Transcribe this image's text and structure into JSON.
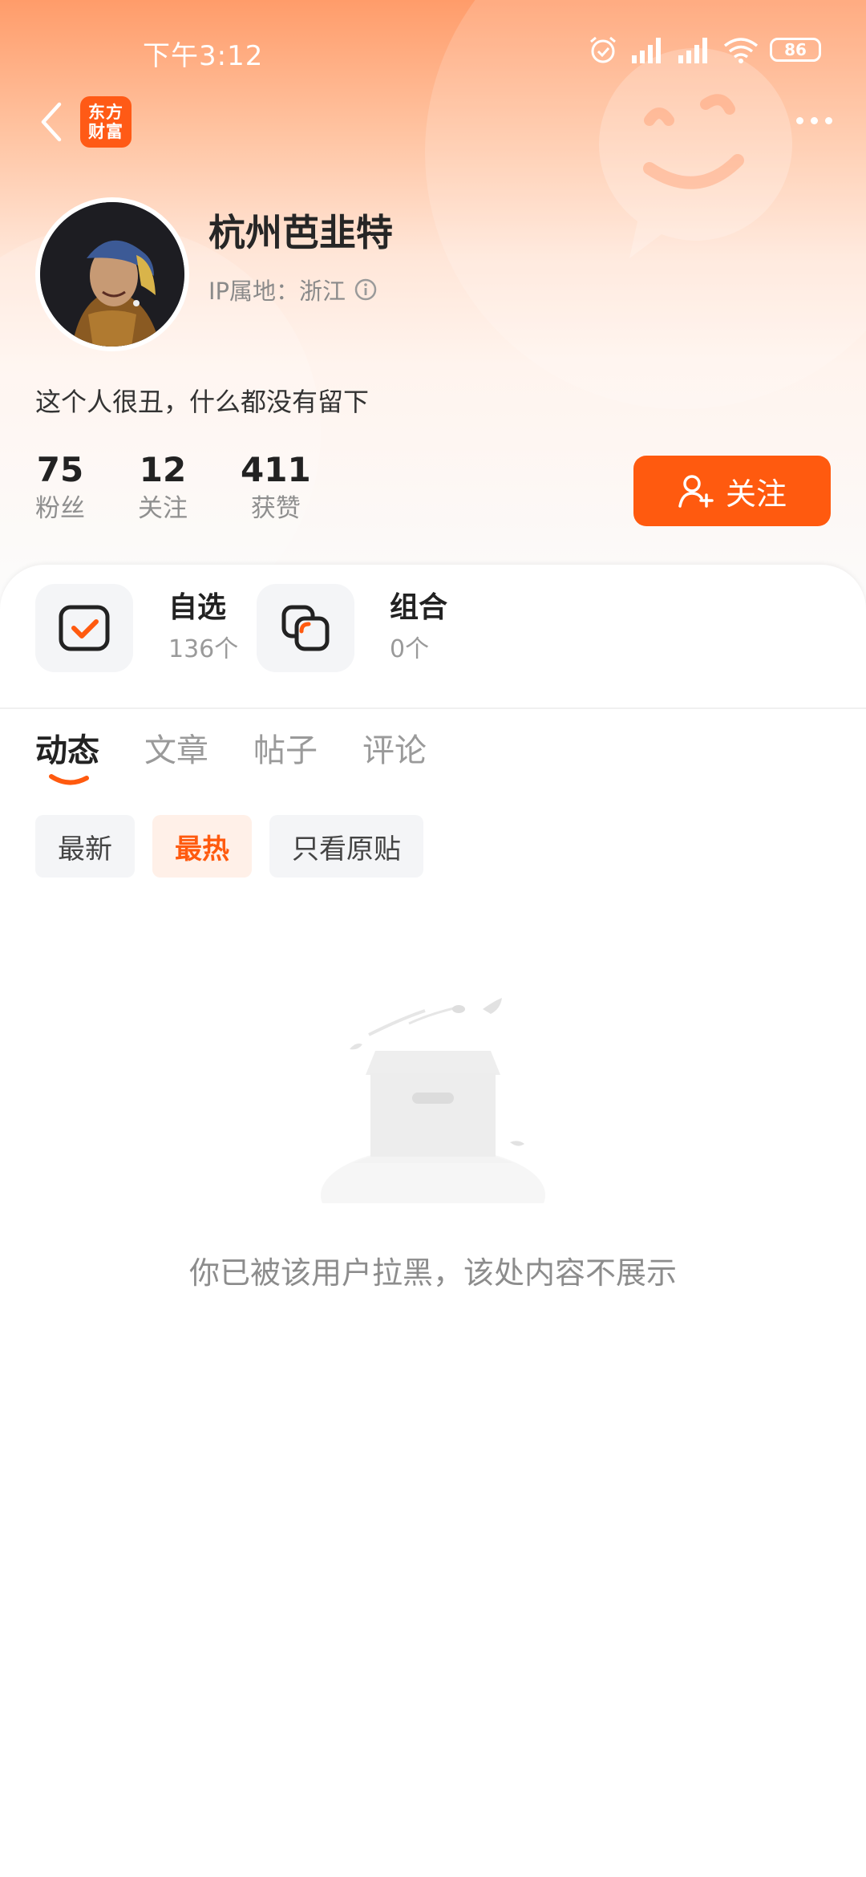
{
  "status_bar": {
    "time": "下午3:12",
    "battery": "86"
  },
  "nav": {
    "logo_line1": "东方",
    "logo_line2": "财富"
  },
  "profile": {
    "name": "杭州芭韭特",
    "ip_location": "IP属地：浙江",
    "bio": "这个人很丑，什么都没有留下",
    "stats": [
      {
        "value": "75",
        "label": "粉丝"
      },
      {
        "value": "12",
        "label": "关注"
      },
      {
        "value": "411",
        "label": "获赞"
      }
    ],
    "follow_label": "关注"
  },
  "quick_links": [
    {
      "title": "自选",
      "count": "136个",
      "icon": "checkbox-icon"
    },
    {
      "title": "组合",
      "count": "0个",
      "icon": "portfolio-icon"
    }
  ],
  "tabs": [
    "动态",
    "文章",
    "帖子",
    "评论"
  ],
  "active_tab": "动态",
  "filters": [
    "最新",
    "最热",
    "只看原贴"
  ],
  "active_filter": "最热",
  "empty_message": "你已被该用户拉黑，该处内容不展示",
  "colors": {
    "accent": "#ff5a0f",
    "header_top": "#ff9c6a"
  }
}
